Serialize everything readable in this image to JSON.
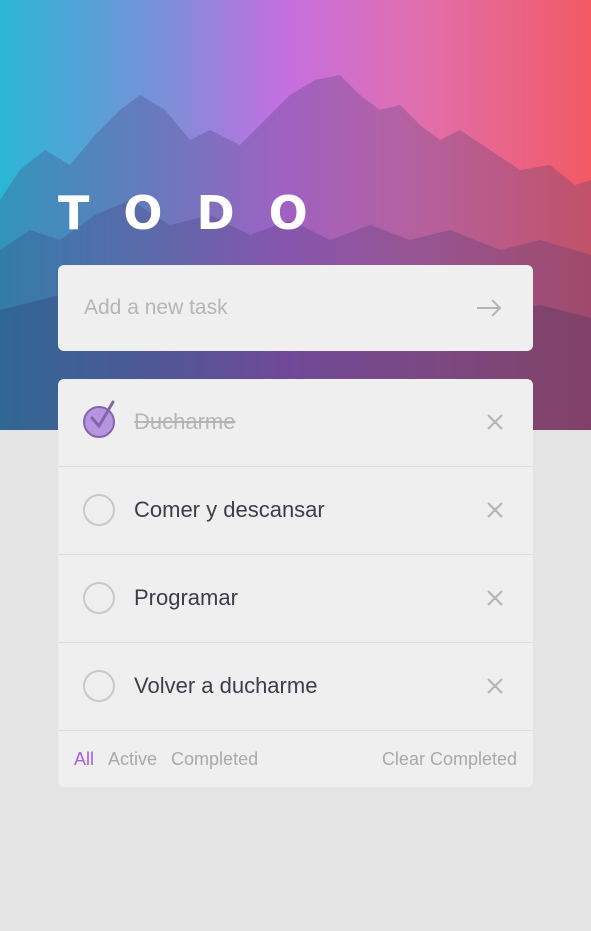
{
  "header": {
    "title": "TODO"
  },
  "new_task": {
    "placeholder": "Add a new task"
  },
  "tasks": [
    {
      "label": "Ducharme",
      "completed": true
    },
    {
      "label": "Comer y descansar",
      "completed": false
    },
    {
      "label": "Programar",
      "completed": false
    },
    {
      "label": "Volver a ducharme",
      "completed": false
    }
  ],
  "footer": {
    "filters": [
      "All",
      "Active",
      "Completed"
    ],
    "active_filter": "All",
    "clear_label": "Clear Completed"
  },
  "colors": {
    "accent": "#a55fd8",
    "check_fill": "#b595e0",
    "background": "#e4e4e4",
    "card": "#efefef"
  }
}
